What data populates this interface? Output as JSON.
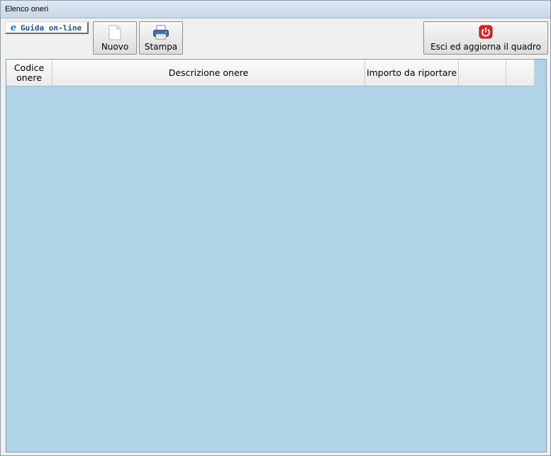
{
  "window": {
    "title": "Elenco oneri"
  },
  "toolbar": {
    "help_label": "Guida on-line",
    "new_label": "Nuovo",
    "print_label": "Stampa",
    "exit_label": "Esci ed aggiorna il quadro"
  },
  "table": {
    "columns": [
      "Codice\nonere",
      "Descrizione onere",
      "Importo da riportare",
      "",
      ""
    ],
    "rows": []
  },
  "colors": {
    "grid_background": "#b0d3e8",
    "exit_icon": "#d9262a",
    "help_text": "#1d4f8c"
  }
}
